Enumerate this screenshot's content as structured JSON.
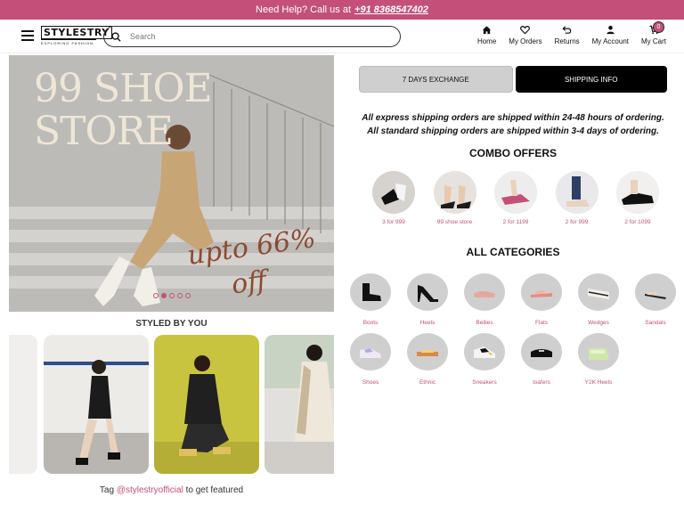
{
  "topbar": {
    "text": "Need Help? Call us at",
    "phone": "+91 8368547402"
  },
  "header": {
    "logo_main": "STYLESTRY",
    "logo_sub": "EXPLORING FASHION",
    "search_placeholder": "Search",
    "nav": [
      {
        "label": "Home",
        "icon": "home-icon"
      },
      {
        "label": "My Orders",
        "icon": "heart-icon"
      },
      {
        "label": "Returns",
        "icon": "return-arrow-icon"
      },
      {
        "label": "My Account",
        "icon": "user-icon"
      },
      {
        "label": "My Cart",
        "icon": "cart-icon"
      }
    ],
    "cart_count": "0"
  },
  "hero": {
    "title_line1": "99 SHOE",
    "title_line2": "STORE",
    "upto": "upto 66%",
    "off": "off",
    "slides": 5,
    "active_slide": 2
  },
  "styled": {
    "title": "STYLED BY YOU",
    "tag_prefix": "Tag ",
    "tag_handle": "@stylestryofficial",
    "tag_suffix": " to get featured"
  },
  "tabs": {
    "exchange": "7 DAYS EXCHANGE",
    "shipping": "SHIPPING INFO"
  },
  "shipping_text": {
    "line1": "All express shipping orders are shipped within 24-48 hours of ordering.",
    "line2": "All standard shipping orders are shipped within 3-4 days of ordering."
  },
  "combo": {
    "title": "COMBO OFFERS",
    "items": [
      "3 for 999",
      "99 shoe store",
      "2 for 1199",
      "2 for 999",
      "2 for 1099"
    ]
  },
  "categories": {
    "title": "ALL CATEGORIES",
    "items": [
      "Boots",
      "Heels",
      "Bellies",
      "Flats",
      "Wedges",
      "Sandals",
      "Shoes",
      "Ethnic",
      "Sneakers",
      "loafers",
      "Y2K Heels"
    ]
  },
  "colors": {
    "accent": "#c4507a",
    "tab_active": "#000000",
    "tab_inactive": "#cfcfcf"
  }
}
